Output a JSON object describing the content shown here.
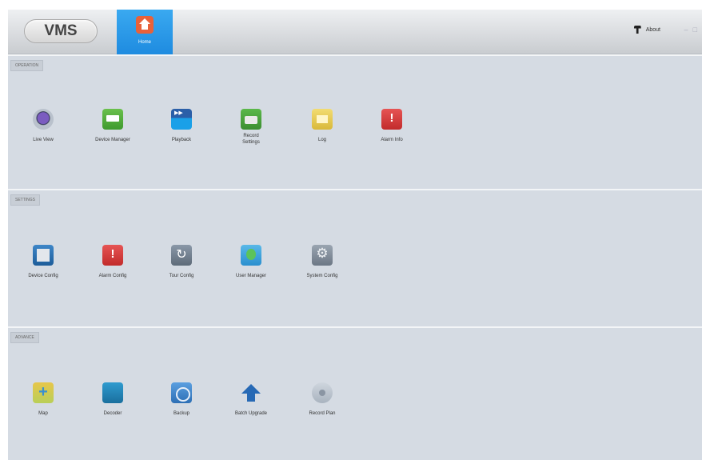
{
  "app": {
    "logo_text": "VMS",
    "home_tab_label": "Home",
    "about_label": "About",
    "window_controls": [
      "–",
      "□"
    ]
  },
  "sections": [
    {
      "title": "OPERATION",
      "items": [
        {
          "label": "Live View",
          "icon": "live-view-icon"
        },
        {
          "label": "Device Manager",
          "icon": "device-manager-icon"
        },
        {
          "label": "Playback",
          "icon": "playback-icon"
        },
        {
          "label": "Record\nSettings",
          "icon": "record-settings-icon"
        },
        {
          "label": "Log",
          "icon": "log-icon"
        },
        {
          "label": "Alarm Info",
          "icon": "alarm-info-icon"
        }
      ]
    },
    {
      "title": "SETTINGS",
      "items": [
        {
          "label": "Device Config",
          "icon": "device-config-icon"
        },
        {
          "label": "Alarm Config",
          "icon": "alarm-config-icon"
        },
        {
          "label": "Tour Config",
          "icon": "tour-config-icon"
        },
        {
          "label": "User Manager",
          "icon": "user-manager-icon"
        },
        {
          "label": "System Config",
          "icon": "system-config-icon"
        }
      ]
    },
    {
      "title": "ADVANCE",
      "items": [
        {
          "label": "Map",
          "icon": "map-icon"
        },
        {
          "label": "Decoder",
          "icon": "decoder-icon"
        },
        {
          "label": "Backup",
          "icon": "backup-icon"
        },
        {
          "label": "Batch Upgrade",
          "icon": "batch-upgrade-icon"
        },
        {
          "label": "Record Plan",
          "icon": "record-plan-icon"
        }
      ]
    }
  ]
}
